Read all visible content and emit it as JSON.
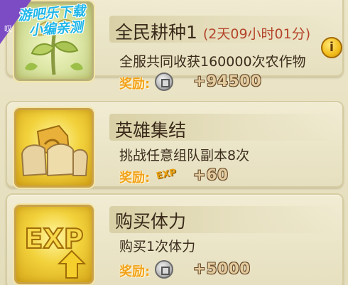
{
  "watermark": {
    "line1": "游吧乐下载",
    "line2": "小编亲测",
    "corner_char": "叹"
  },
  "tasks": [
    {
      "title": "全民耕种1",
      "countdown": "(2天09小时01分)",
      "description": "全服共同收获160000次农作物",
      "reward_label": "奖励:",
      "reward_icon": "silver-coin-icon",
      "reward_amount": "+94500",
      "has_info_button": true
    },
    {
      "title": "英雄集结",
      "countdown": "",
      "description": "挑战任意组队副本8次",
      "reward_label": "奖励:",
      "reward_icon": "exp-icon",
      "reward_icon_text": "EXP",
      "reward_amount": "+60"
    },
    {
      "title": "购买体力",
      "countdown": "",
      "description": "购买1次体力",
      "reward_label": "奖励:",
      "reward_icon": "silver-coin-icon",
      "reward_amount": "+5000"
    }
  ],
  "info_button_glyph": "i",
  "colors": {
    "countdown": "#b4442a",
    "reward_label": "#f2a21a",
    "panel": "#ece6c9"
  }
}
